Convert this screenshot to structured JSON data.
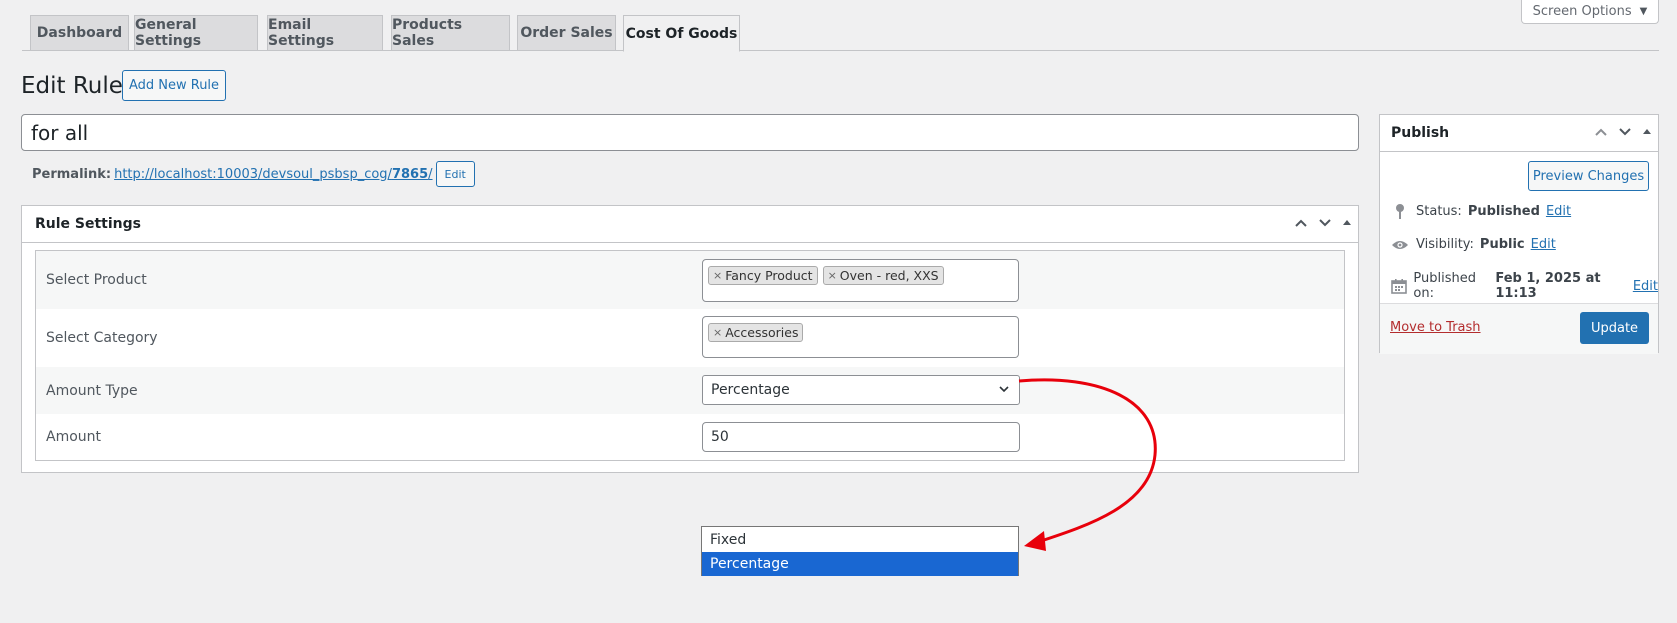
{
  "screen_options": {
    "label": "Screen Options",
    "caret": "▼"
  },
  "tabs": [
    {
      "label": "Dashboard"
    },
    {
      "label": "General Settings"
    },
    {
      "label": "Email Settings"
    },
    {
      "label": "Products Sales"
    },
    {
      "label": "Order Sales"
    },
    {
      "label": "Cost Of Goods"
    }
  ],
  "active_tab": "Cost Of Goods",
  "heading": {
    "title": "Edit Rule",
    "add_new": "Add New Rule"
  },
  "post_title": "for all",
  "permalink": {
    "label": "Permalink:",
    "url_base": "http://localhost:10003/devsoul_psbsp_cog/",
    "slug": "7865",
    "trailing": "/",
    "edit": "Edit"
  },
  "rule_settings": {
    "title": "Rule Settings",
    "rows": {
      "product": {
        "label": "Select Product",
        "chips": [
          "Fancy Product",
          "Oven - red, XXS"
        ]
      },
      "category": {
        "label": "Select Category",
        "chips": [
          "Accessories"
        ]
      },
      "amount_type": {
        "label": "Amount Type",
        "value": "Percentage"
      },
      "amount": {
        "label": "Amount",
        "value": "50"
      }
    }
  },
  "dropdown_options": [
    {
      "label": "Fixed",
      "selected": false
    },
    {
      "label": "Percentage",
      "selected": true
    }
  ],
  "publish": {
    "title": "Publish",
    "preview": "Preview Changes",
    "status_label": "Status:",
    "status_value": "Published",
    "visibility_label": "Visibility:",
    "visibility_value": "Public",
    "published_label": "Published on:",
    "published_value": "Feb 1, 2025 at 11:13",
    "edit": "Edit",
    "trash": "Move to Trash",
    "update": "Update"
  },
  "chip_remove": "×",
  "colors": {
    "accent": "#2271b1",
    "selected_option": "#1967d2",
    "annotation_arrow": "#e8000b",
    "trash": "#b32d2e"
  }
}
